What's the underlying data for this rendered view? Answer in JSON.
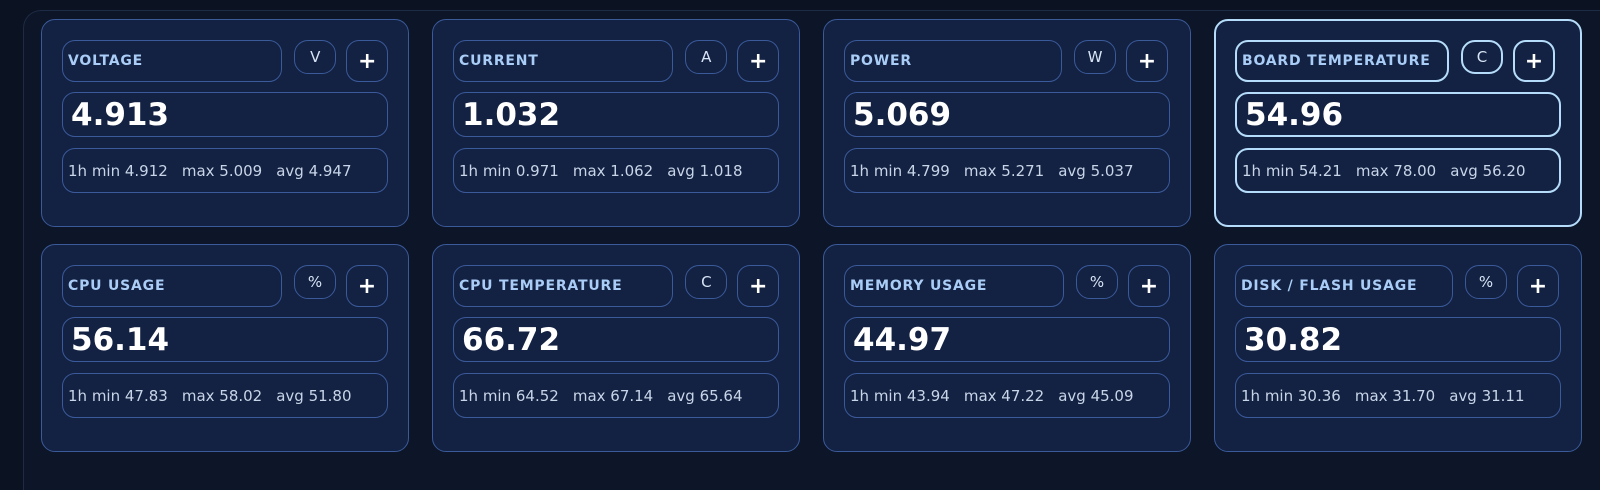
{
  "cards": [
    {
      "label": "VOLTAGE",
      "unit": "V",
      "add": "+",
      "value": "4.913",
      "min": "1h min 4.912",
      "max": "max 5.009",
      "avg": "avg 4.947"
    },
    {
      "label": "CURRENT",
      "unit": "A",
      "add": "+",
      "value": "1.032",
      "min": "1h min 0.971",
      "max": "max 1.062",
      "avg": "avg 1.018"
    },
    {
      "label": "POWER",
      "unit": "W",
      "add": "+",
      "value": "5.069",
      "min": "1h min 4.799",
      "max": "max 5.271",
      "avg": "avg 5.037"
    },
    {
      "label": "BOARD TEMPERATURE",
      "unit": "C",
      "add": "+",
      "value": "54.96",
      "min": "1h min 54.21",
      "max": "max 78.00",
      "avg": "avg 56.20"
    },
    {
      "label": "CPU USAGE",
      "unit": "%",
      "add": "+",
      "value": "56.14",
      "min": "1h min 47.83",
      "max": "max 58.02",
      "avg": "avg 51.80"
    },
    {
      "label": "CPU TEMPERATURE",
      "unit": "C",
      "add": "+",
      "value": "66.72",
      "min": "1h min 64.52",
      "max": "max 67.14",
      "avg": "avg 65.64"
    },
    {
      "label": "MEMORY USAGE",
      "unit": "%",
      "add": "+",
      "value": "44.97",
      "min": "1h min 43.94",
      "max": "max 47.22",
      "avg": "avg 45.09"
    },
    {
      "label": "DISK / FLASH USAGE",
      "unit": "%",
      "add": "+",
      "value": "30.82",
      "min": "1h min 30.36",
      "max": "max 31.70",
      "avg": "avg 31.11"
    }
  ],
  "colors": {
    "background": "#0b1222",
    "card": "#132142",
    "border": "#3a5a9a",
    "active_border": "#b5ddfb",
    "label": "#a9cdf6"
  }
}
